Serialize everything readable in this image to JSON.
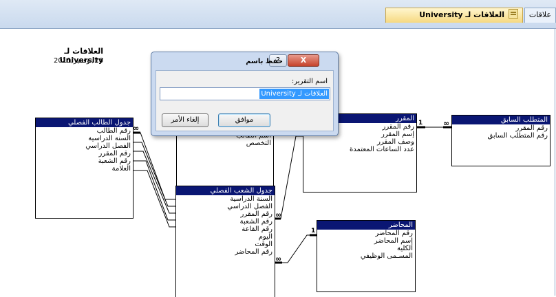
{
  "tabs": {
    "relations_label": "علاقات",
    "active_label": "العلاقات لـ University"
  },
  "report": {
    "title": "العلاقات لـ University",
    "date": "26/نوفمبر/2011"
  },
  "tables": {
    "student_class": {
      "title": "جدول الطالب الفصلي",
      "fields": [
        "رقم الطالب",
        "السنة الدراسية",
        "الفصل الدراسي",
        "رقم المقرر",
        "رقم الشعبة",
        "العلامة"
      ]
    },
    "students": {
      "fields": [
        "اسم الطالب",
        "التخصص"
      ]
    },
    "course": {
      "title": "المقرر",
      "fields": [
        "رقم المقرر",
        "إسم المقرر",
        "وصف المقرر",
        "عدد الساعات المعتمدة"
      ]
    },
    "prereq": {
      "title": "المتطلب السابق",
      "fields": [
        "رقم المقرر",
        "رقم المتطلب السابق"
      ]
    },
    "section": {
      "title": "جدول الشعب الفصلي",
      "fields": [
        "السنة الدراسية",
        "الفصل الدراسي",
        "رقم المقرر",
        "رقم الشعبة",
        "رقم القاعة",
        "اليوم",
        "الوقت",
        "رقم المحاضر"
      ]
    },
    "lecturer": {
      "title": "المحاضر",
      "fields": [
        "رقم المحاضر",
        "إسم المحاضر",
        "الكلية",
        "المسـمى الوظيفي"
      ]
    }
  },
  "relationship": {
    "one": "1",
    "many": "∞"
  },
  "dialog": {
    "title": "حفظ باسم",
    "help": "?",
    "close": "X",
    "label": "اسم التقرير:",
    "value": "العلاقات لـ University",
    "ok": "موافق",
    "cancel": "إلغاء الأمر"
  }
}
